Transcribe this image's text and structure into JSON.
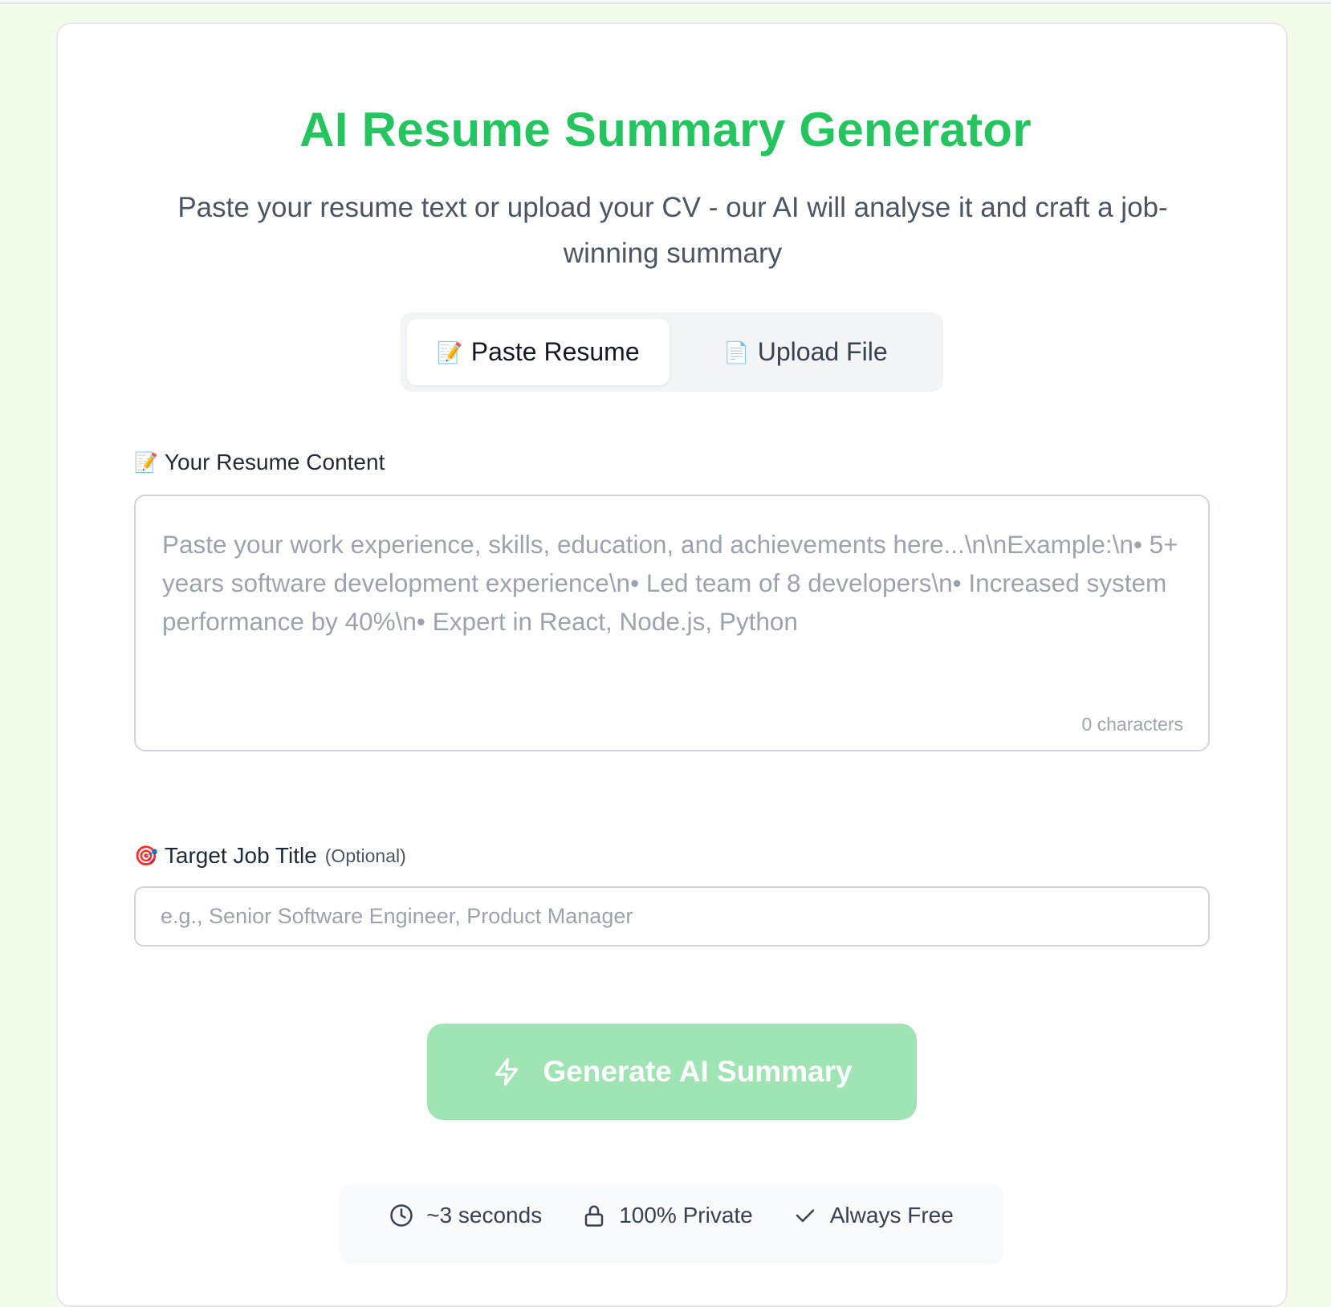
{
  "header": {
    "title": "AI Resume Summary Generator",
    "subtitle": "Paste your resume text or upload your CV - our AI will analyse it and craft a job-winning summary"
  },
  "tabs": [
    {
      "icon": "📝",
      "label": "Paste Resume",
      "active": true
    },
    {
      "icon": "📄",
      "label": "Upload File",
      "active": false
    }
  ],
  "resume": {
    "label_icon": "📝",
    "label": "Your Resume Content",
    "value": "",
    "placeholder": "Paste your work experience, skills, education, and achievements here...\\n\\nExample:\\n• 5+ years software development experience\\n• Led team of 8 developers\\n• Increased system performance by 40%\\n• Expert in React, Node.js, Python",
    "char_count": "0 characters"
  },
  "job_title": {
    "label_icon": "🎯",
    "label": "Target Job Title",
    "optional": "(Optional)",
    "value": "",
    "placeholder": "e.g., Senior Software Engineer, Product Manager"
  },
  "generate": {
    "label": "Generate AI Summary",
    "icon": "lightning-icon",
    "disabled": true,
    "color": "#9fe5b3"
  },
  "features": [
    {
      "icon": "clock-icon",
      "label": "~3 seconds"
    },
    {
      "icon": "lock-icon",
      "label": "100% Private"
    },
    {
      "icon": "check-icon",
      "label": "Always Free"
    }
  ],
  "colors": {
    "accent": "#22c55e",
    "background": "#f2fce9"
  }
}
